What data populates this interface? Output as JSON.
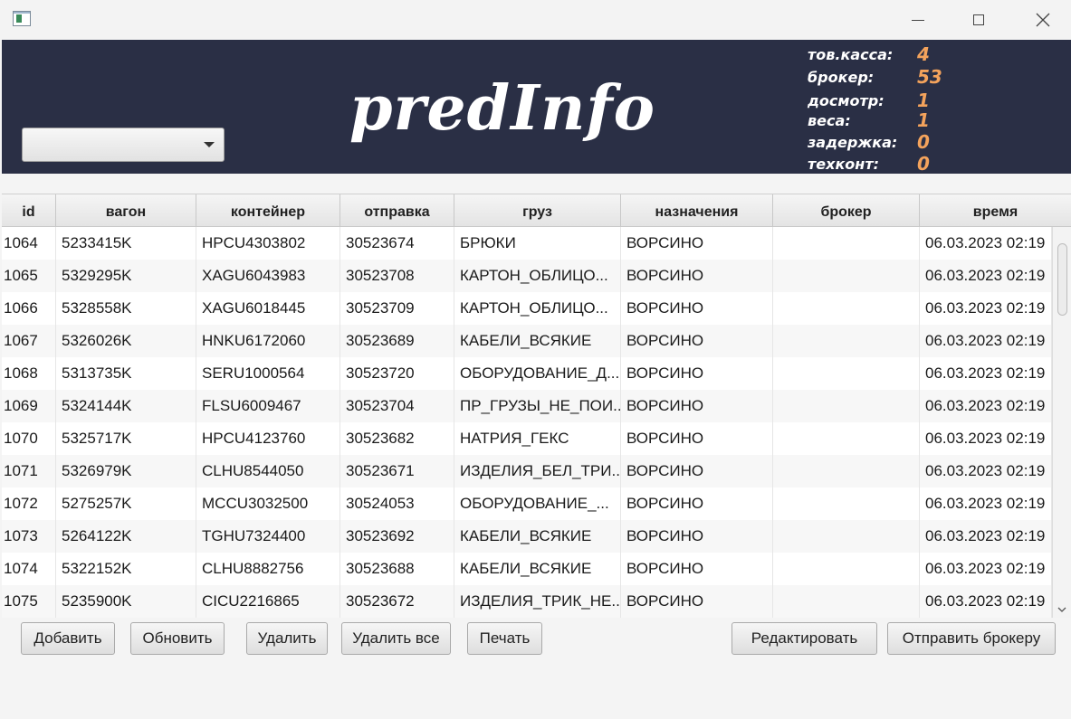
{
  "header": {
    "title": "predInfo",
    "combo_value": "",
    "stats": [
      {
        "label": "тов.касса:",
        "value": "4"
      },
      {
        "label": "брокер:",
        "value": "53"
      },
      {
        "label": "досмотр:",
        "value": "1"
      },
      {
        "label": "веса:",
        "value": "1"
      },
      {
        "label": "задержка:",
        "value": "0"
      },
      {
        "label": "техконт:",
        "value": "0"
      }
    ],
    "colors": {
      "background": "#2a2f45",
      "stat_value": "#f4a35c"
    }
  },
  "table": {
    "columns": [
      "id",
      "вагон",
      "контейнер",
      "отправка",
      "груз",
      "назначения",
      "брокер",
      "время"
    ],
    "rows": [
      [
        "1064",
        "5233415K",
        "HPCU4303802",
        "30523674",
        "БРЮКИ",
        "ВОРСИНО",
        "",
        "06.03.2023 02:19"
      ],
      [
        "1065",
        "5329295K",
        "XAGU6043983",
        "30523708",
        "КАРТОН_ОБЛИЦО...",
        "ВОРСИНО",
        "",
        "06.03.2023 02:19"
      ],
      [
        "1066",
        "5328558K",
        "XAGU6018445",
        "30523709",
        "КАРТОН_ОБЛИЦО...",
        "ВОРСИНО",
        "",
        "06.03.2023 02:19"
      ],
      [
        "1067",
        "5326026K",
        "HNKU6172060",
        "30523689",
        "КАБЕЛИ_ВСЯКИЕ",
        "ВОРСИНО",
        "",
        "06.03.2023 02:19"
      ],
      [
        "1068",
        "5313735K",
        "SERU1000564",
        "30523720",
        "ОБОРУДОВАНИЕ_Д...",
        "ВОРСИНО",
        "",
        "06.03.2023 02:19"
      ],
      [
        "1069",
        "5324144K",
        "FLSU6009467",
        "30523704",
        "ПР_ГРУЗЫ_НЕ_ПОИ...",
        "ВОРСИНО",
        "",
        "06.03.2023 02:19"
      ],
      [
        "1070",
        "5325717K",
        "HPCU4123760",
        "30523682",
        "НАТРИЯ_ГЕКС",
        "ВОРСИНО",
        "",
        "06.03.2023 02:19"
      ],
      [
        "1071",
        "5326979K",
        "CLHU8544050",
        "30523671",
        "ИЗДЕЛИЯ_БЕЛ_ТРИ...",
        "ВОРСИНО",
        "",
        "06.03.2023 02:19"
      ],
      [
        "1072",
        "5275257K",
        "MCCU3032500",
        "30524053",
        "ОБОРУДОВАНИЕ_...",
        "ВОРСИНО",
        "",
        "06.03.2023 02:19"
      ],
      [
        "1073",
        "5264122K",
        "TGHU7324400",
        "30523692",
        "КАБЕЛИ_ВСЯКИЕ",
        "ВОРСИНО",
        "",
        "06.03.2023 02:19"
      ],
      [
        "1074",
        "5322152K",
        "CLHU8882756",
        "30523688",
        "КАБЕЛИ_ВСЯКИЕ",
        "ВОРСИНО",
        "",
        "06.03.2023 02:19"
      ],
      [
        "1075",
        "5235900K",
        "CICU2216865",
        "30523672",
        "ИЗДЕЛИЯ_ТРИК_НЕ...",
        "ВОРСИНО",
        "",
        "06.03.2023 02:19"
      ]
    ]
  },
  "buttons": {
    "add": "Добавить",
    "refresh": "Обновить",
    "delete": "Удалить",
    "delete_all": "Удалить все",
    "print": "Печать",
    "edit": "Редактировать",
    "send_broker": "Отправить брокеру"
  },
  "icons": {
    "app": "app-window-icon",
    "minimize": "minimize-icon",
    "maximize": "maximize-icon",
    "close": "close-icon",
    "combo_arrow": "chevron-down-icon",
    "scroll_down": "scroll-down-arrow-icon"
  }
}
